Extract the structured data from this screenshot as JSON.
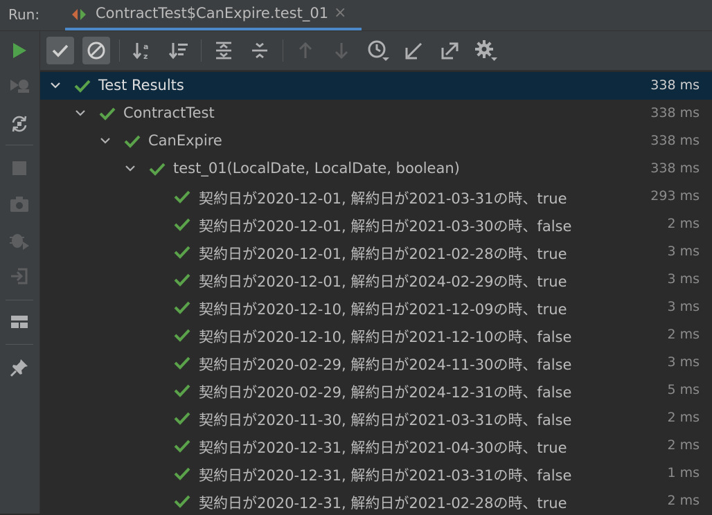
{
  "run_label": "Run:",
  "tab": {
    "title": "ContractTest$CanExpire.test_01",
    "close": "×"
  },
  "colors": {
    "pass_green": "#5aa34a",
    "run_green": "#4fa14c",
    "selection": "#0d293e",
    "accent": "#4a88c7"
  },
  "left_toolbar": [
    {
      "name": "run-icon",
      "enabled": true
    },
    {
      "name": "debug-failed-icon",
      "enabled": false
    },
    {
      "name": "rerun-auto-icon",
      "enabled": true
    },
    {
      "name": "stop-icon",
      "enabled": false
    },
    {
      "name": "camera-icon",
      "enabled": false
    },
    {
      "name": "export-bug-icon",
      "enabled": false
    },
    {
      "name": "import-icon",
      "enabled": false
    },
    {
      "name": "layout-icon",
      "enabled": true
    },
    {
      "name": "pin-icon",
      "enabled": true
    }
  ],
  "toolbar": [
    {
      "name": "show-passed-icon",
      "toggled": true
    },
    {
      "name": "show-ignored-icon",
      "toggled": true
    },
    {
      "name": "sort-alpha-icon",
      "toggled": false
    },
    {
      "name": "sort-duration-icon",
      "toggled": false
    },
    {
      "name": "expand-all-icon",
      "toggled": false
    },
    {
      "name": "collapse-all-icon",
      "toggled": false
    },
    {
      "name": "prev-failed-icon",
      "toggled": false
    },
    {
      "name": "next-failed-icon",
      "toggled": false
    },
    {
      "name": "history-icon",
      "toggled": false
    },
    {
      "name": "import-results-icon",
      "toggled": false
    },
    {
      "name": "export-results-icon",
      "toggled": false
    },
    {
      "name": "settings-icon",
      "toggled": false
    }
  ],
  "tree": {
    "root": {
      "label": "Test Results",
      "duration": "338 ms"
    },
    "class": {
      "label": "ContractTest",
      "duration": "338 ms"
    },
    "nested": {
      "label": "CanExpire",
      "duration": "338 ms"
    },
    "method": {
      "label": "test_01(LocalDate, LocalDate, boolean)",
      "duration": "338 ms"
    },
    "cases": [
      {
        "label": "契約日が2020-12-01, 解約日が2021-03-31の時、true",
        "duration": "293 ms"
      },
      {
        "label": "契約日が2020-12-01, 解約日が2021-03-30の時、false",
        "duration": "2 ms"
      },
      {
        "label": "契約日が2020-12-01, 解約日が2021-02-28の時、true",
        "duration": "3 ms"
      },
      {
        "label": "契約日が2020-12-01, 解約日が2024-02-29の時、true",
        "duration": "3 ms"
      },
      {
        "label": "契約日が2020-12-10, 解約日が2021-12-09の時、true",
        "duration": "3 ms"
      },
      {
        "label": "契約日が2020-12-10, 解約日が2021-12-10の時、false",
        "duration": "2 ms"
      },
      {
        "label": "契約日が2020-02-29, 解約日が2024-11-30の時、false",
        "duration": "3 ms"
      },
      {
        "label": "契約日が2020-02-29, 解約日が2024-12-31の時、false",
        "duration": "5 ms"
      },
      {
        "label": "契約日が2020-11-30, 解約日が2021-03-31の時、false",
        "duration": "2 ms"
      },
      {
        "label": "契約日が2020-12-31, 解約日が2021-04-30の時、true",
        "duration": "2 ms"
      },
      {
        "label": "契約日が2020-12-31, 解約日が2021-03-31の時、false",
        "duration": "1 ms"
      },
      {
        "label": "契約日が2020-12-31, 解約日が2021-02-28の時、true",
        "duration": "2 ms"
      }
    ]
  }
}
